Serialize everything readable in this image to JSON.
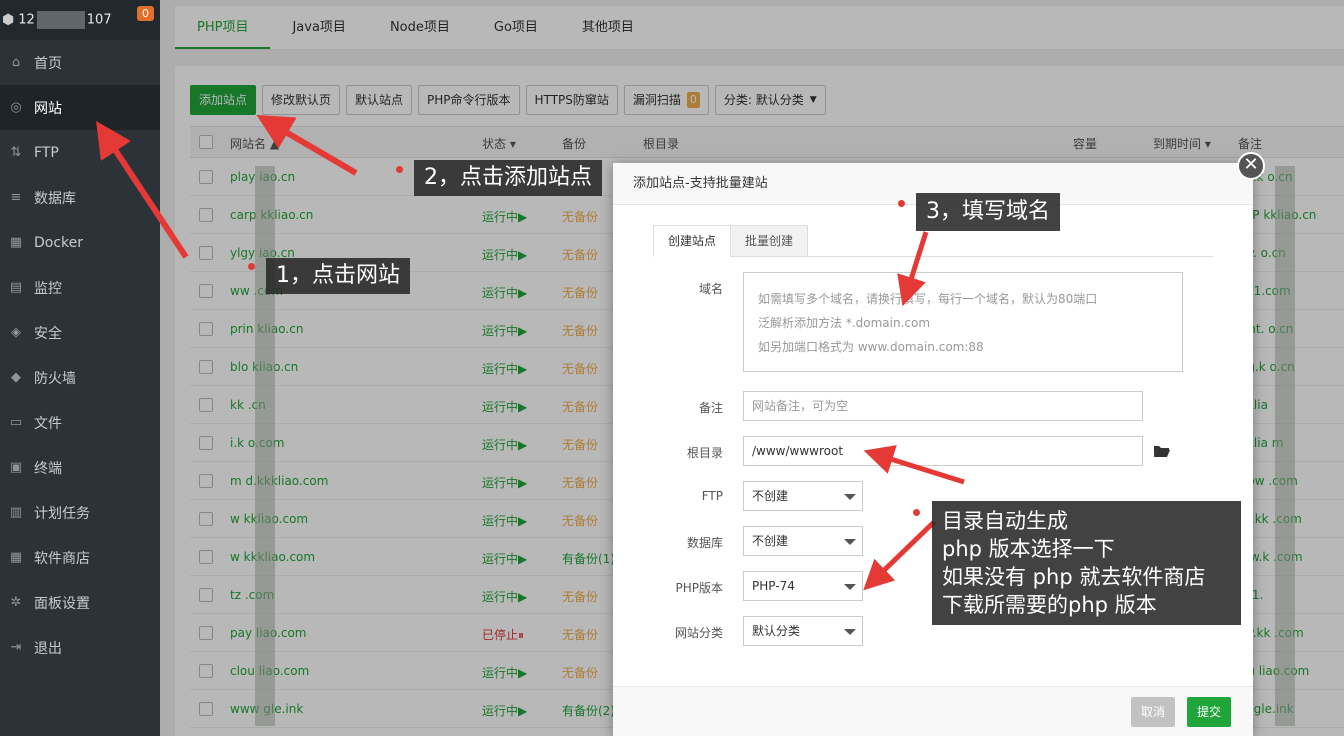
{
  "header": {
    "ip_start": "12",
    "ip_end": "107",
    "alert_count": "0"
  },
  "sidebar": {
    "items": [
      {
        "label": "首页",
        "icon": "home-icon",
        "glyph": "⌂"
      },
      {
        "label": "网站",
        "icon": "globe-icon",
        "glyph": "◎"
      },
      {
        "label": "FTP",
        "icon": "ftp-icon",
        "glyph": "⇅"
      },
      {
        "label": "数据库",
        "icon": "database-icon",
        "glyph": "≡"
      },
      {
        "label": "Docker",
        "icon": "docker-icon",
        "glyph": "▦"
      },
      {
        "label": "监控",
        "icon": "monitor-icon",
        "glyph": "▤"
      },
      {
        "label": "安全",
        "icon": "shield-icon",
        "glyph": "◈"
      },
      {
        "label": "防火墙",
        "icon": "firewall-icon",
        "glyph": "◆"
      },
      {
        "label": "文件",
        "icon": "folder-icon",
        "glyph": "▭"
      },
      {
        "label": "终端",
        "icon": "terminal-icon",
        "glyph": "▣"
      },
      {
        "label": "计划任务",
        "icon": "calendar-icon",
        "glyph": "▥"
      },
      {
        "label": "软件商店",
        "icon": "apps-icon",
        "glyph": "▦"
      },
      {
        "label": "面板设置",
        "icon": "gear-icon",
        "glyph": "✲"
      },
      {
        "label": "退出",
        "icon": "logout-icon",
        "glyph": "⇥"
      }
    ]
  },
  "top_tabs": [
    "PHP项目",
    "Java项目",
    "Node项目",
    "Go项目",
    "其他项目"
  ],
  "toolbar": {
    "add_site": "添加站点",
    "edit_default": "修改默认页",
    "default_site": "默认站点",
    "php_cli": "PHP命令行版本",
    "https_guard": "HTTPS防窜站",
    "vuln_scan": "漏洞扫描",
    "vuln_count": "0",
    "category": "分类: 默认分类"
  },
  "table": {
    "headers": {
      "name": "网站名 ▲",
      "status": "状态 ▾",
      "backup": "备份",
      "root": "根目录",
      "capacity": "容量",
      "expire": "到期时间 ▾",
      "note": "备注"
    },
    "rows": [
      {
        "name": "play        iao.cn",
        "status": "",
        "backup": "",
        "note": "ay.k      o.cn"
      },
      {
        "name": "carp     kkliao.cn",
        "status": "运行中▶",
        "backup": "无备份",
        "note": "arP     kkliao.cn"
      },
      {
        "name": "ylgy      iao.cn",
        "status": "运行中▶",
        "backup": "无备份",
        "note": "gy.       o.cn"
      },
      {
        "name": "ww        .com",
        "status": "运行中▶",
        "backup": "无备份",
        "note": "w        1.com"
      },
      {
        "name": "prin     kliao.cn",
        "status": "运行中▶",
        "backup": "无备份",
        "note": "rint.      o.cn"
      },
      {
        "name": "blo      kliao.cn",
        "status": "运行中▶",
        "backup": "无备份",
        "note": "og.k      o.cn"
      },
      {
        "name": "kk        .cn",
        "status": "运行中▶",
        "backup": "无备份",
        "note": "kklia"
      },
      {
        "name": "i.k      o.com",
        "status": "运行中▶",
        "backup": "无备份",
        "note": "kklia      m"
      },
      {
        "name": "m      d.kkkliao.com",
        "status": "运行中▶",
        "backup": "无备份",
        "note": "ypw     .com"
      },
      {
        "name": "w      kkliao.com",
        "status": "运行中▶",
        "backup": "无备份",
        "note": "ifi.kk      .com"
      },
      {
        "name": "w      kkkliao.com",
        "status": "运行中▶",
        "backup": "有备份(1)",
        "note": "ww.k       .com"
      },
      {
        "name": "tz        .com",
        "status": "运行中▶",
        "backup": "无备份",
        "note": "h-1."
      },
      {
        "name": "pay       liao.com",
        "status": "已停止⏸",
        "backup": "无备份",
        "note": "ay.kk      .com"
      },
      {
        "name": "clou      liao.com",
        "status": "运行中▶",
        "backup": "无备份",
        "note": "ou      liao.com"
      },
      {
        "name": "www       gle.ink",
        "status": "运行中▶",
        "backup": "有备份(2)",
        "note": "w       gle.ink"
      }
    ]
  },
  "modal": {
    "title": "添加站点-支持批量建站",
    "tabs": [
      "创建站点",
      "批量创建"
    ],
    "domain_label": "域名",
    "domain_placeholder_lines": [
      "如需填写多个域名，请换行填写，每行一个域名，默认为80端口",
      "泛解析添加方法 *.domain.com",
      "如另加端口格式为 www.domain.com:88"
    ],
    "note_label": "备注",
    "note_placeholder": "网站备注，可为空",
    "root_label": "根目录",
    "root_value": "/www/wwwroot",
    "ftp_label": "FTP",
    "ftp_value": "不创建",
    "db_label": "数据库",
    "db_value": "不创建",
    "php_label": "PHP版本",
    "php_value": "PHP-74",
    "category_label": "网站分类",
    "category_value": "默认分类",
    "cancel": "取消",
    "submit": "提交",
    "close": "✕"
  },
  "annotations": {
    "step1": "1，点击网站",
    "step2": "2，点击添加站点",
    "step3": "3，填写域名",
    "note_lines": [
      "目录自动生成",
      "php 版本选择一下",
      "如果没有 php 就去软件商店",
      "下载所需要的php 版本"
    ]
  },
  "colors": {
    "accent": "#20a53a",
    "sidebar_bg": "#2c3338",
    "arrow": "#e53935",
    "badge": "#e0702a"
  }
}
